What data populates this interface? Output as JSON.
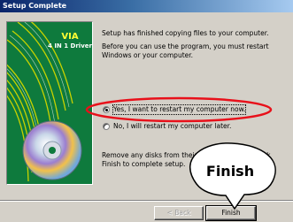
{
  "window": {
    "title": "Setup Complete"
  },
  "artwork": {
    "brand_name": "VIA",
    "brand_subtitle": "4 IN 1 Driver",
    "colors": {
      "background": "#0e7a3d",
      "stripe": "#c8d200",
      "brand": "#ffff33"
    }
  },
  "content": {
    "paragraph1": "Setup has finished copying files to your computer.",
    "paragraph2": "Before you can use the program, you must restart Windows or your computer.",
    "options": [
      {
        "label": "Yes, I want to restart my computer now.",
        "selected": true
      },
      {
        "label": "No, I will restart my computer later.",
        "selected": false
      }
    ],
    "paragraph3": "Remove any disks from their drives, and then click Finish to complete setup."
  },
  "buttons": {
    "back_label": "< Back",
    "finish_label": "Finish"
  },
  "callout": {
    "label": "Finish",
    "color": "#e8101a"
  }
}
